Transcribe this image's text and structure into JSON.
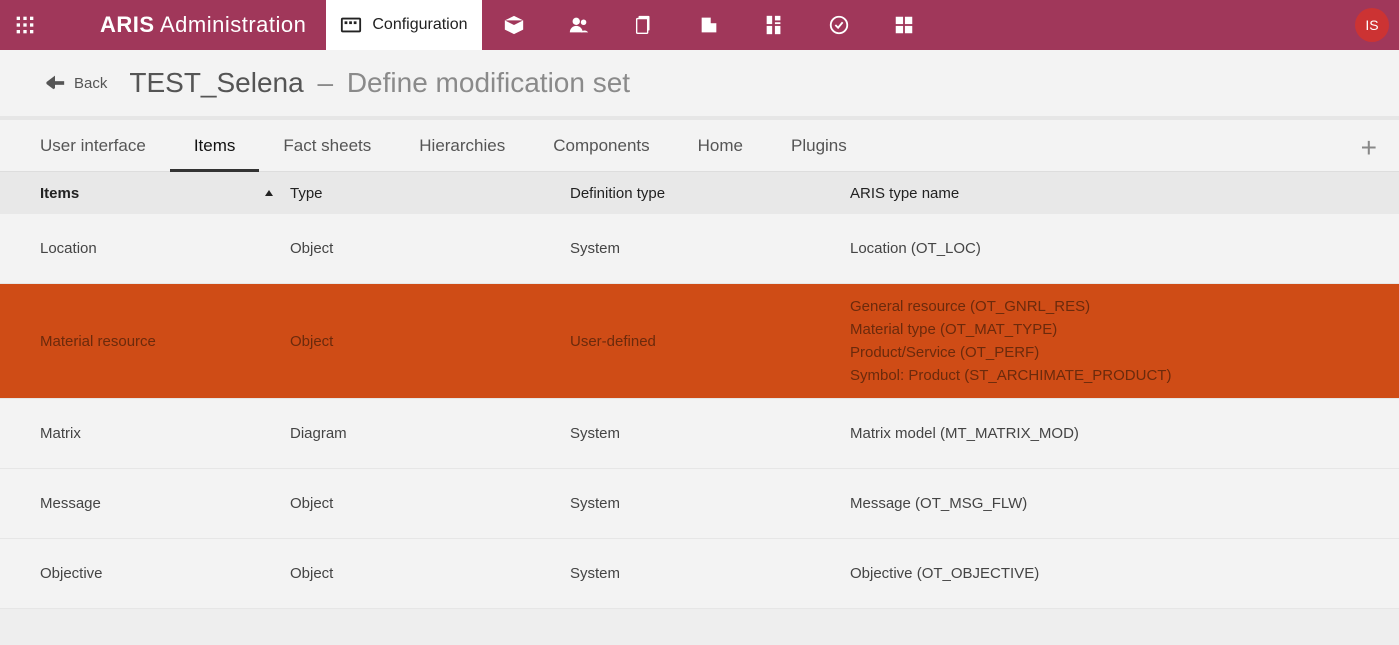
{
  "brand": {
    "bold": "ARIS",
    "light": "Administration"
  },
  "topnav": {
    "active_label": "Configuration"
  },
  "avatar": "IS",
  "breadcrumb": {
    "back": "Back",
    "title": "TEST_Selena",
    "dash": "–",
    "subtitle": "Define modification set"
  },
  "subtabs": [
    "User interface",
    "Items",
    "Fact sheets",
    "Hierarchies",
    "Components",
    "Home",
    "Plugins"
  ],
  "subtabs_active": 1,
  "add_label": "+",
  "table": {
    "headers": {
      "items": "Items",
      "type": "Type",
      "def": "Definition type",
      "aris": "ARIS type name"
    },
    "rows": [
      {
        "items": "Location",
        "type": "Object",
        "def": "System",
        "aris": [
          "Location (OT_LOC)"
        ],
        "selected": false
      },
      {
        "items": "Material resource",
        "type": "Object",
        "def": "User-defined",
        "aris": [
          "General resource (OT_GNRL_RES)",
          "Material type (OT_MAT_TYPE)",
          "Product/Service (OT_PERF)",
          "Symbol: Product (ST_ARCHIMATE_PRODUCT)"
        ],
        "selected": true
      },
      {
        "items": "Matrix",
        "type": "Diagram",
        "def": "System",
        "aris": [
          "Matrix model (MT_MATRIX_MOD)"
        ],
        "selected": false
      },
      {
        "items": "Message",
        "type": "Object",
        "def": "System",
        "aris": [
          "Message (OT_MSG_FLW)"
        ],
        "selected": false
      },
      {
        "items": "Objective",
        "type": "Object",
        "def": "System",
        "aris": [
          "Objective (OT_OBJECTIVE)"
        ],
        "selected": false
      }
    ]
  }
}
